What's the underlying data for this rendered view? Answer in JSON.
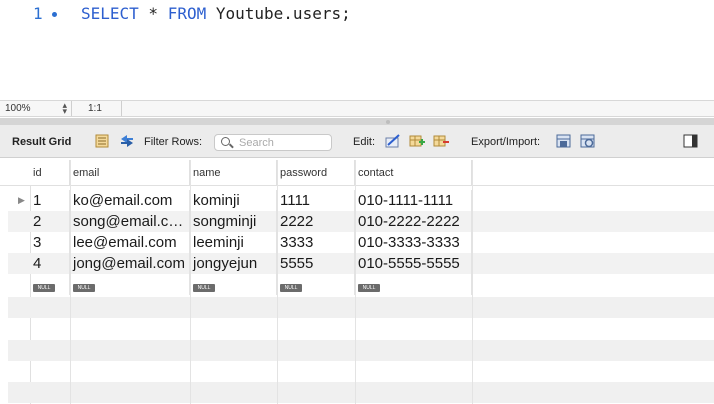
{
  "editor": {
    "line_number": "1",
    "kw_select": "SELECT",
    "star": " * ",
    "kw_from": "FROM",
    "table": " Youtube.users;"
  },
  "zoom": {
    "value": "100%",
    "ratio": "1:1"
  },
  "toolbar": {
    "result_grid": "Result Grid",
    "filter_rows": "Filter Rows:",
    "search_placeholder": "Search",
    "edit": "Edit:",
    "export_import": "Export/Import:"
  },
  "grid": {
    "columns": [
      "id",
      "email",
      "name",
      "password",
      "contact"
    ],
    "rows": [
      [
        "1",
        "ko@email.com",
        "kominji",
        "1111",
        "010-1111-1111"
      ],
      [
        "2",
        "song@email.com",
        "songminji",
        "2222",
        "010-2222-2222"
      ],
      [
        "3",
        "lee@email.com",
        "leeminji",
        "3333",
        "010-3333-3333"
      ],
      [
        "4",
        "jong@email.com",
        "jongyejun",
        "5555",
        "010-5555-5555"
      ]
    ],
    "null_label": "NULL",
    "row_marker": "▶"
  },
  "colors": {
    "keyword": "#2d5fcf",
    "line_number": "#2c6fd1"
  }
}
